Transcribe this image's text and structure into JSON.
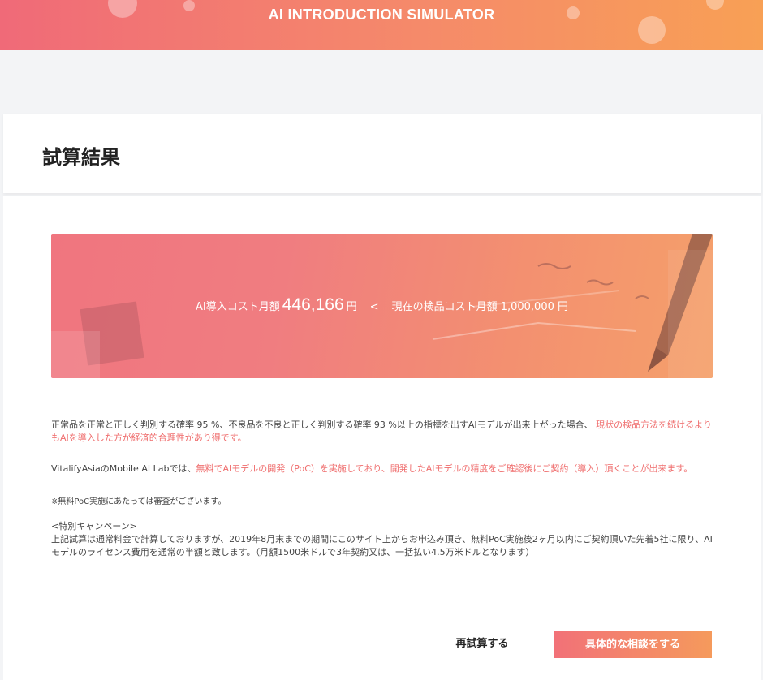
{
  "header": {
    "title": "AI INTRODUCTION SIMULATOR"
  },
  "page": {
    "title": "試算結果"
  },
  "result": {
    "ai_cost_label": "AI導入コスト月額",
    "ai_cost_value": "446,166",
    "ai_cost_unit": "円",
    "comparator": "<",
    "current_cost_label": "現在の検品コスト月額 1,000,000 円"
  },
  "paragraphs": {
    "p1_normal": "正常品を正常と正しく判別する確率 95 %、不良品を不良と正しく判別する確率 93 %以上の指標を出すAIモデルが出来上がった場合、",
    "p1_accent": "現状の検品方法を続けるよりもAIを導入した方が経済的合理性があり得です。",
    "p2_normal": "VitalifyAsiaのMobile AI Labでは、",
    "p2_accent": "無料でAIモデルの開発（PoC）を実施しており、開発したAIモデルの精度をご確認後にご契約（導入）頂くことが出来ます。",
    "note": "※無料PoC実施にあたっては審査がございます。",
    "campaign_heading": "<特別キャンペーン>",
    "campaign_body": "上記試算は通常料金で計算しておりますが、2019年8月末までの期間にこのサイト上からお申込み頂き、無料PoC実施後2ヶ月以内にご契約頂いた先着5社に限り、AIモデルのライセンス費用を通常の半額と致します。（月額1500米ドルで3年契約又は、一括払い4.5万米ドルとなります）"
  },
  "actions": {
    "retry_label": "再試算する",
    "consult_label": "具体的な相談をする"
  }
}
